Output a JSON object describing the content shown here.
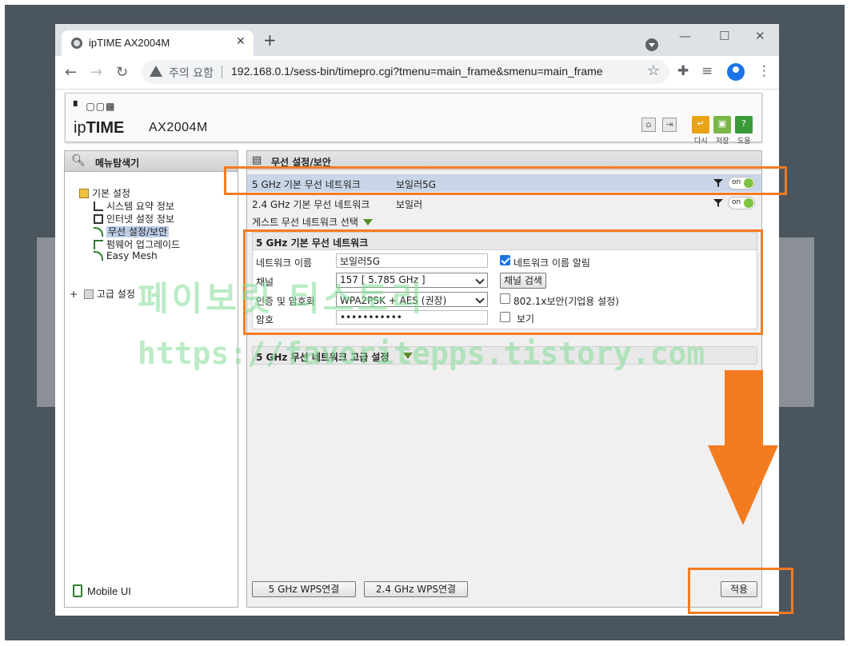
{
  "browser": {
    "tab_title": "ipTIME AX2004M",
    "tab_close": "✕",
    "new_tab": "+",
    "security_warning": "주의 요함",
    "url": "192.168.0.1/sess-bin/timepro.cgi?tmenu=main_frame&smenu=main_frame",
    "window_min": "—",
    "window_max": "☐",
    "window_close": "✕"
  },
  "header": {
    "logo_dots": "▘ ▢▢▩",
    "logo_ip": "ip",
    "logo_time": "TIME",
    "model": "AX2004M",
    "buttons": [
      {
        "label": "다시",
        "color": "#e8a317"
      },
      {
        "label": "저장",
        "color": "#7ab648"
      },
      {
        "label": "도움",
        "color": "#3a9a3a"
      }
    ]
  },
  "sidebar": {
    "title": "메뉴탐색기",
    "basic_settings": "기본 설정",
    "items": [
      {
        "label": "시스템 요약 정보"
      },
      {
        "label": "인터넷 설정 정보"
      },
      {
        "label": "무선 설정/보안"
      },
      {
        "label": "펌웨어 업그레이드"
      },
      {
        "label": "Easy Mesh"
      }
    ],
    "advanced_settings": "고급 설정",
    "plus": "+",
    "mobile_ui": "Mobile UI"
  },
  "main": {
    "title": "무선 설정/보안",
    "networks": [
      {
        "name": "5 GHz 기본 무선 네트워크",
        "ssid": "보일러5G",
        "toggle": "on"
      },
      {
        "name": "2.4 GHz 기본 무선 네트워크",
        "ssid": "보일러",
        "toggle": "on"
      }
    ],
    "guest_label": "게스트 무선 네트워크 선택",
    "section_title": "5 GHz 기본 무선 네트워크",
    "fields": {
      "network_name_label": "네트워크 이름",
      "network_name_value": "보일러5G",
      "broadcast_label": "네트워크 이름 알림",
      "channel_label": "채널",
      "channel_value": "157 [ 5.785 GHz ]",
      "channel_scan": "채널 검색",
      "auth_label": "인증 및 암호화",
      "auth_value": "WPA2PSK + AES (권장)",
      "enterprise_label": "802.1x보안(기업용 설정)",
      "password_label": "암호",
      "password_value": "•••••••••••",
      "show_label": "보기"
    },
    "advanced_section": "5 GHz 무선 네트워크 고급 설정",
    "wps_5g": "5 GHz WPS연결",
    "wps_24g": "2.4 GHz WPS연결",
    "apply": "적용"
  },
  "watermark": {
    "line1": "페이보릿 티스토리",
    "line2": "https://favoritepps.tistory.com"
  },
  "colors": {
    "annotation": "#f47c20",
    "toggle_on": "#7dc242",
    "selected_row": "#c9d6e8"
  }
}
